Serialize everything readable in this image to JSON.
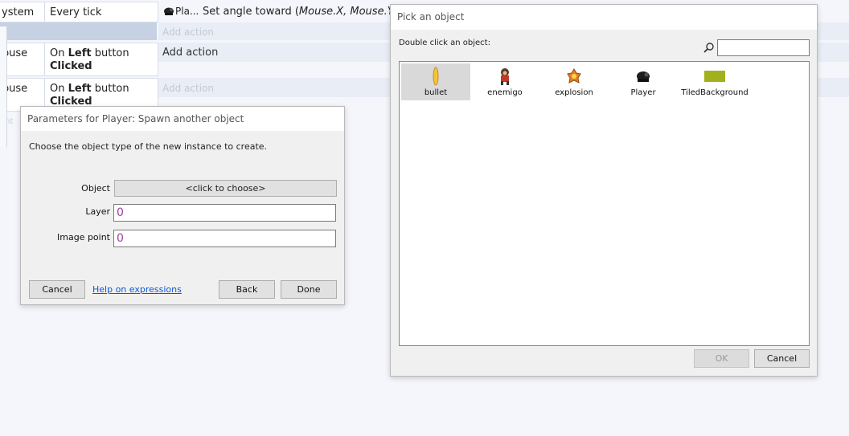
{
  "event_sheet": {
    "rows": [
      {
        "object": "ystem",
        "condition": "Every tick",
        "action_icon_label": "Pla...",
        "action_text": "Set angle toward (",
        "action_params": "Mouse.X, Mouse.Y",
        "action_close": ")"
      },
      {
        "add_action": "Add action"
      },
      {
        "object": "Mouse",
        "condition_prefix": "On ",
        "condition_bold": "Left",
        "condition_suffix": " button",
        "condition_line2": "Clicked",
        "add_action": "Add action"
      },
      {
        "object": "Mouse",
        "condition_prefix": "On ",
        "condition_bold": "Left",
        "condition_suffix": " button",
        "condition_line2": "Clicked",
        "add_action": "Add action"
      }
    ],
    "partial_label": "ent"
  },
  "params_dialog": {
    "title": "Parameters for Player: Spawn another object",
    "description": "Choose the object type of the new instance to create.",
    "object_label": "Object",
    "object_value": "<click to choose>",
    "layer_label": "Layer",
    "layer_value": "0",
    "image_point_label": "Image point",
    "image_point_value": "0",
    "cancel": "Cancel",
    "help": "Help on expressions",
    "back": "Back",
    "done": "Done"
  },
  "picker_dialog": {
    "title": "Pick an object",
    "prompt": "Double click an object:",
    "search_value": "",
    "objects": [
      {
        "name": "bullet",
        "icon": "bullet-icon",
        "selected": true
      },
      {
        "name": "enemigo",
        "icon": "enemy-icon",
        "selected": false
      },
      {
        "name": "explosion",
        "icon": "explosion-icon",
        "selected": false
      },
      {
        "name": "Player",
        "icon": "player-icon",
        "selected": false
      },
      {
        "name": "TiledBackground",
        "icon": "tiled-background-icon",
        "selected": false
      }
    ],
    "ok": "OK",
    "cancel": "Cancel"
  },
  "colors": {
    "background": "#f4f6fb",
    "action_strip": "#e8edf6",
    "selection": "#d9d9d9",
    "link": "#0a58d6",
    "param_value": "#a03fa0",
    "tiled_bg_swatch": "#a3b01d"
  }
}
